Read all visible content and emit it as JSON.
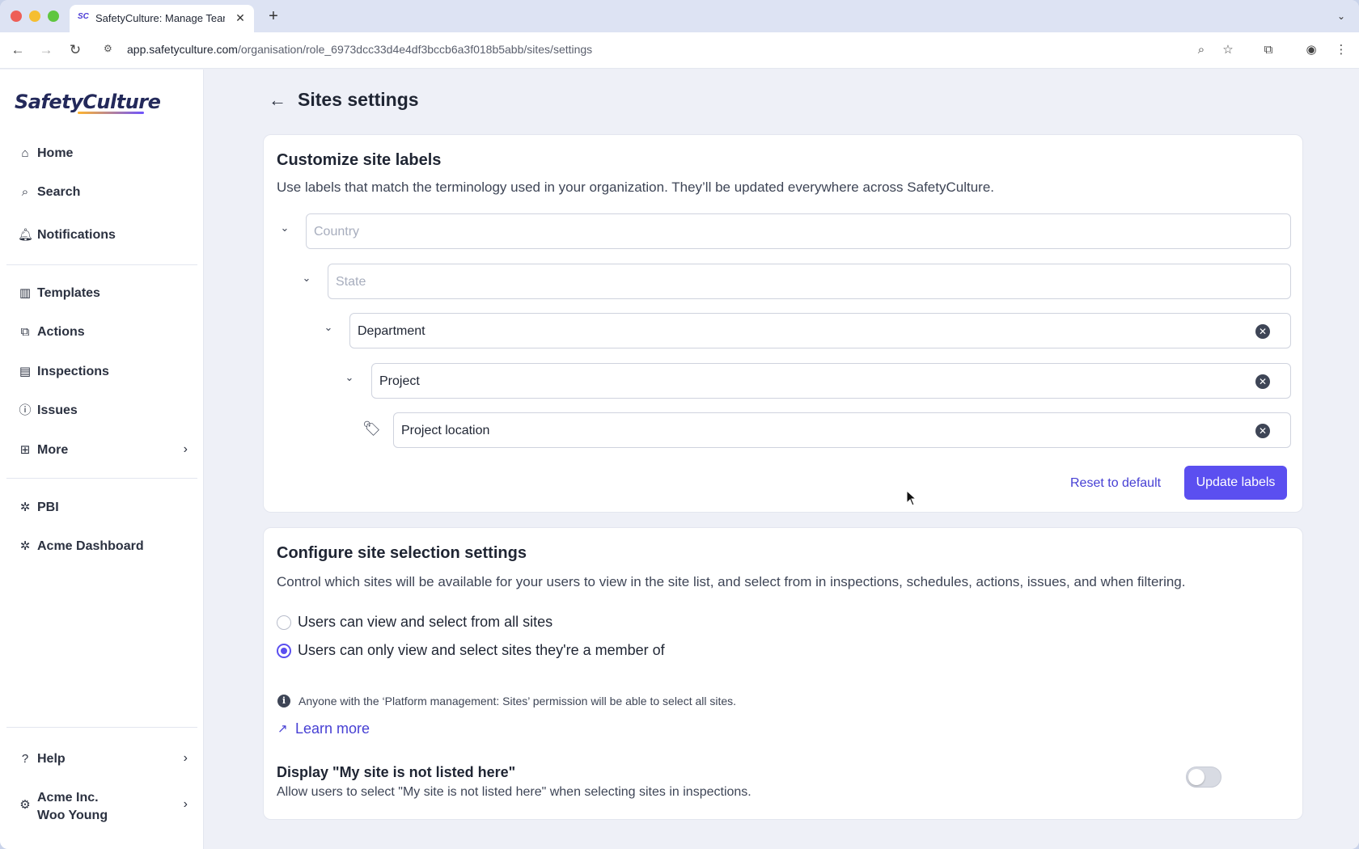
{
  "browser": {
    "tab_title": "SafetyCulture: Manage Teams",
    "tab_favicon": "SC",
    "url_host": "app.safetyculture.com",
    "url_path": "/organisation/role_6973dcc33d4e4df3bccb6a3f018b5abb/sites/settings"
  },
  "sidebar": {
    "logo": "SafetyCulture",
    "items_top": [
      {
        "label": "Home",
        "icon": "home-icon"
      },
      {
        "label": "Search",
        "icon": "search-icon"
      },
      {
        "label": "Notifications",
        "icon": "bell-icon"
      }
    ],
    "items_main": [
      {
        "label": "Templates",
        "icon": "templates-icon"
      },
      {
        "label": "Actions",
        "icon": "actions-icon"
      },
      {
        "label": "Inspections",
        "icon": "inspections-icon"
      },
      {
        "label": "Issues",
        "icon": "issues-icon"
      },
      {
        "label": "More",
        "icon": "grid-icon"
      }
    ],
    "items_integrations": [
      {
        "label": "PBI",
        "icon": "puzzle-icon"
      },
      {
        "label": "Acme Dashboard",
        "icon": "puzzle-icon"
      }
    ],
    "help": {
      "label": "Help",
      "icon": "help-icon"
    },
    "account": {
      "org": "Acme Inc.",
      "user": "Woo Young",
      "icon": "gear-icon"
    }
  },
  "page": {
    "title": "Sites settings"
  },
  "labels_card": {
    "title": "Customize site labels",
    "description": "Use labels that match the terminology used in your organization. They’ll be updated everywhere across SafetyCulture.",
    "levels": [
      {
        "value": "",
        "placeholder": "Country"
      },
      {
        "value": "",
        "placeholder": "State"
      },
      {
        "value": "Department",
        "placeholder": ""
      },
      {
        "value": "Project",
        "placeholder": ""
      },
      {
        "value": "Project location",
        "placeholder": ""
      }
    ],
    "reset_label": "Reset to default",
    "update_label": "Update labels"
  },
  "selection_card": {
    "title": "Configure site selection settings",
    "description": "Control which sites will be available for your users to view in the site list, and select from in inspections, schedules, actions, issues, and when filtering.",
    "options": [
      {
        "label": "Users can view and select from all sites",
        "checked": false
      },
      {
        "label": "Users can only view and select sites they're a member of",
        "checked": true
      }
    ],
    "info_text": "Anyone with the ‘Platform management: Sites’ permission will be able to select all sites.",
    "learn_more": "Learn more",
    "toggle_title": "Display \"My site is not listed here\"",
    "toggle_description": "Allow users to select \"My site is not listed here\" when selecting sites in inspections.",
    "toggle_on": false
  },
  "colors": {
    "accent": "#5b4ff0",
    "link": "#4740d4"
  }
}
